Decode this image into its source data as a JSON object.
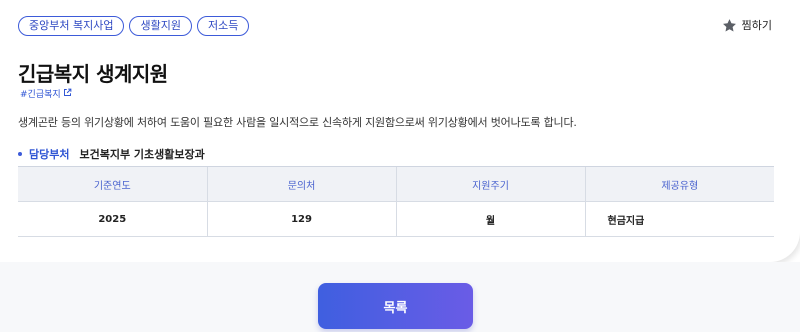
{
  "tags": [
    "중앙부처 복지사업",
    "생활지원",
    "저소득"
  ],
  "bookmark": {
    "label": "찜하기",
    "icon": "star-icon"
  },
  "title": "긴급복지 생계지원",
  "hashtag": {
    "label": "#긴급복지",
    "icon": "external-link-icon"
  },
  "description": "생계곤란 등의 위기상황에 처하여 도움이 필요한 사람을 일시적으로 신속하게 지원함으로써 위기상황에서 벗어나도록 합니다.",
  "department": {
    "label": "담당부처",
    "value": "보건복지부 기초생활보장과"
  },
  "table": {
    "headers": [
      "기준연도",
      "문의처",
      "지원주기",
      "제공유형"
    ],
    "row": [
      "2025",
      "129",
      "월",
      "현금지급"
    ]
  },
  "list_button": {
    "label": "목록"
  },
  "colors": {
    "accent": "#3d5bd9",
    "button_start": "#3f5fe0",
    "button_end": "#6a5ce6"
  }
}
